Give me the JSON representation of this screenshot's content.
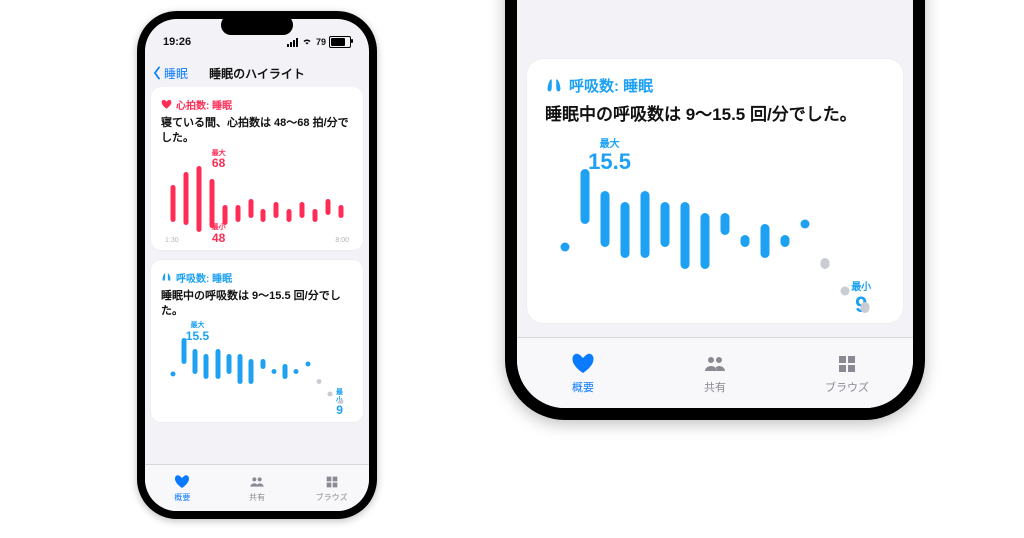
{
  "status": {
    "time": "19:26",
    "battery": "79"
  },
  "nav": {
    "back": "睡眠",
    "title": "睡眠のハイライト"
  },
  "card_hr": {
    "caption": "心拍数: 睡眠",
    "desc": "寝ている間、心拍数は 48〜68 拍/分でした。",
    "max_label": "最大",
    "max_value": "68",
    "min_label": "最小",
    "min_value": "48",
    "x_start": "1:30",
    "x_end": "8:00"
  },
  "card_resp": {
    "caption": "呼吸数: 睡眠",
    "desc": "睡眠中の呼吸数は 9〜15.5 回/分でした。",
    "max_label": "最大",
    "max_value": "15.5",
    "min_label": "最小",
    "min_value": "9"
  },
  "tabs": {
    "summary": "概要",
    "share": "共有",
    "browse": "ブラウズ"
  },
  "chart_data": [
    {
      "type": "range-bar",
      "metric": "heart_rate_sleep",
      "unit": "bpm",
      "color": "#ff2d55",
      "title": "心拍数: 睡眠",
      "x_range": [
        "1:30",
        "8:00"
      ],
      "y_range": [
        48,
        68
      ],
      "max_label": "最大",
      "max_value": 68,
      "min_label": "最小",
      "min_value": 48,
      "bars": [
        {
          "lo": 51,
          "hi": 62
        },
        {
          "lo": 50,
          "hi": 66
        },
        {
          "lo": 48,
          "hi": 68
        },
        {
          "lo": 49,
          "hi": 64
        },
        {
          "lo": 50,
          "hi": 56
        },
        {
          "lo": 51,
          "hi": 56
        },
        {
          "lo": 52,
          "hi": 58
        },
        {
          "lo": 51,
          "hi": 55
        },
        {
          "lo": 52,
          "hi": 57
        },
        {
          "lo": 51,
          "hi": 55
        },
        {
          "lo": 52,
          "hi": 57
        },
        {
          "lo": 51,
          "hi": 55
        },
        {
          "lo": 53,
          "hi": 58
        },
        {
          "lo": 52,
          "hi": 56
        }
      ]
    },
    {
      "type": "range-bar",
      "metric": "respiratory_rate_sleep",
      "unit": "breaths/min",
      "color": "#1ea1f2",
      "title": "呼吸数: 睡眠",
      "y_range": [
        9,
        15.5
      ],
      "max_label": "最大",
      "max_value": 15.5,
      "min_label": "最小",
      "min_value": 9,
      "bars": [
        {
          "lo": 12.0,
          "hi": 12.0,
          "dot": true
        },
        {
          "lo": 13.0,
          "hi": 15.5
        },
        {
          "lo": 12.0,
          "hi": 14.5
        },
        {
          "lo": 11.5,
          "hi": 14.0
        },
        {
          "lo": 11.5,
          "hi": 14.5
        },
        {
          "lo": 12.0,
          "hi": 14.0
        },
        {
          "lo": 11.0,
          "hi": 14.0
        },
        {
          "lo": 11.0,
          "hi": 13.5
        },
        {
          "lo": 12.5,
          "hi": 13.5
        },
        {
          "lo": 12.0,
          "hi": 12.5
        },
        {
          "lo": 11.5,
          "hi": 13.0
        },
        {
          "lo": 12.0,
          "hi": 12.5
        },
        {
          "lo": 13.0,
          "hi": 13.0,
          "dot": true
        },
        {
          "lo": 11.0,
          "hi": 11.5,
          "grey": true
        },
        {
          "lo": 10.0,
          "hi": 10.0,
          "dot": true,
          "grey": true
        },
        {
          "lo": 9.0,
          "hi": 9.5,
          "grey": true
        }
      ]
    }
  ]
}
